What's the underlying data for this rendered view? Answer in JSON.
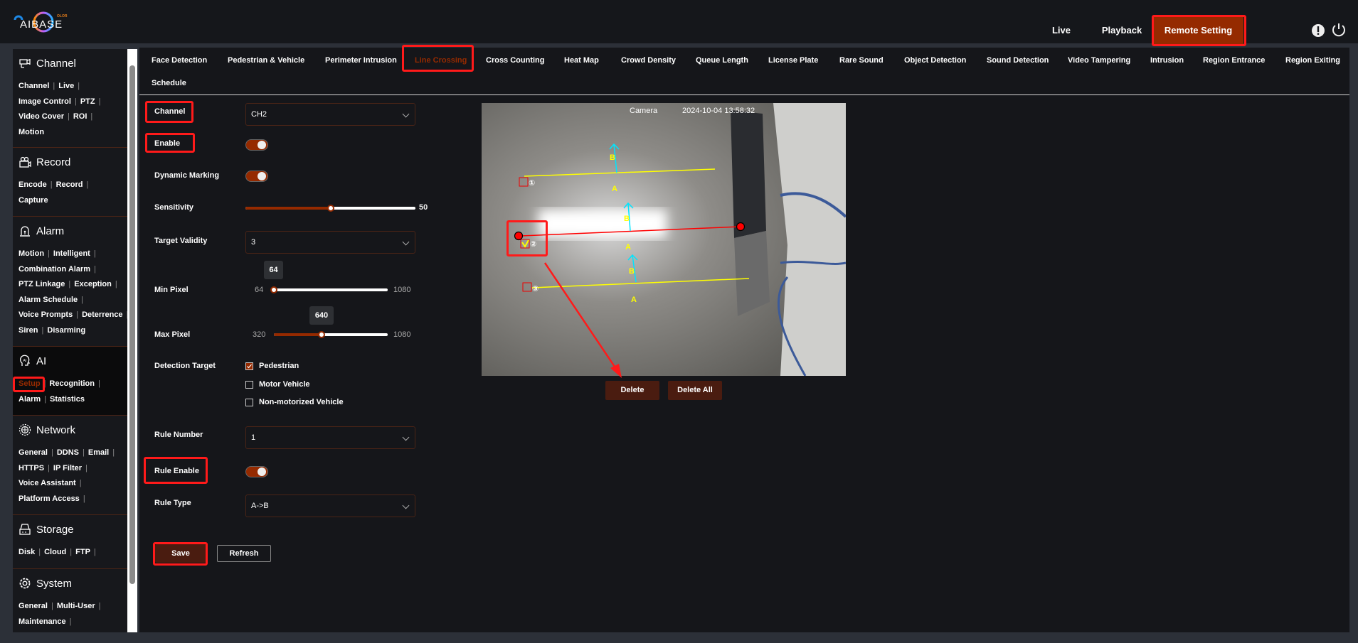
{
  "header": {
    "logo_text": "AIBASE",
    "logo_sub": "OLOR",
    "nav": [
      {
        "label": "Live"
      },
      {
        "label": "Playback"
      },
      {
        "label": "Remote Setting",
        "active": true
      }
    ],
    "icons": [
      "alert-icon",
      "power-icon"
    ]
  },
  "sidebar": {
    "sections": [
      {
        "title": "Channel",
        "icon": "camera-icon",
        "links": [
          "Channel",
          "Live",
          "Image Control",
          "PTZ",
          "Video Cover",
          "ROI",
          "Motion"
        ],
        "rows": [
          [
            0,
            1
          ],
          [
            2,
            3
          ],
          [
            4,
            5
          ],
          [
            6
          ]
        ]
      },
      {
        "title": "Record",
        "icon": "record-icon",
        "links": [
          "Encode",
          "Record",
          "Capture"
        ],
        "rows": [
          [
            0,
            1
          ],
          [
            2
          ]
        ]
      },
      {
        "title": "Alarm",
        "icon": "alarm-icon",
        "links": [
          "Motion",
          "Intelligent",
          "Combination Alarm",
          "PTZ Linkage",
          "Exception",
          "Alarm Schedule",
          "Voice Prompts",
          "Deterrence",
          "Siren",
          "Disarming"
        ],
        "rows": [
          [
            0,
            1
          ],
          [
            2
          ],
          [
            3,
            4
          ],
          [
            5
          ],
          [
            6,
            7
          ],
          [
            8,
            9
          ]
        ]
      },
      {
        "title": "AI",
        "icon": "ai-icon",
        "active": true,
        "links": [
          "Setup",
          "Recognition",
          "Alarm",
          "Statistics"
        ],
        "rows": [
          [
            0,
            1
          ],
          [
            2,
            3
          ]
        ],
        "active_link": "Setup"
      },
      {
        "title": "Network",
        "icon": "network-icon",
        "links": [
          "General",
          "DDNS",
          "Email",
          "HTTPS",
          "IP Filter",
          "Voice Assistant",
          "Platform Access"
        ],
        "rows": [
          [
            0,
            1,
            2
          ],
          [
            3,
            4
          ],
          [
            5
          ],
          [
            6
          ]
        ]
      },
      {
        "title": "Storage",
        "icon": "storage-icon",
        "links": [
          "Disk",
          "Cloud",
          "FTP"
        ],
        "rows": [
          [
            0,
            1,
            2
          ]
        ]
      },
      {
        "title": "System",
        "icon": "gear-icon",
        "links": [
          "General",
          "Multi-User",
          "Maintenance"
        ],
        "rows": [
          [
            0,
            1
          ],
          [
            2
          ]
        ]
      }
    ]
  },
  "tabs": [
    "Face Detection",
    "Pedestrian & Vehicle",
    "Perimeter Intrusion",
    "Line Crossing",
    "Cross Counting",
    "Heat Map",
    "Crowd Density",
    "Queue Length",
    "License Plate",
    "Rare Sound",
    "Object Detection",
    "Sound Detection",
    "Video Tampering",
    "Intrusion",
    "Region Entrance",
    "Region Exiting",
    "Schedule"
  ],
  "active_tab": "Line Crossing",
  "form": {
    "channel": {
      "label": "Channel",
      "value": "CH2"
    },
    "enable": {
      "label": "Enable",
      "on": true
    },
    "dynamic_marking": {
      "label": "Dynamic Marking",
      "on": true
    },
    "sensitivity": {
      "label": "Sensitivity",
      "value": "50",
      "min": 0,
      "max": 100
    },
    "target_validity": {
      "label": "Target Validity",
      "value": "3"
    },
    "min_pixel": {
      "label": "Min Pixel",
      "value": "64",
      "min": "64",
      "max": "1080"
    },
    "max_pixel": {
      "label": "Max Pixel",
      "value": "640",
      "min": "320",
      "max": "1080"
    },
    "detection_target": {
      "label": "Detection Target",
      "options": [
        {
          "label": "Pedestrian",
          "checked": true
        },
        {
          "label": "Motor Vehicle",
          "checked": false
        },
        {
          "label": "Non-motorized Vehicle",
          "checked": false
        }
      ]
    },
    "rule_number": {
      "label": "Rule Number",
      "value": "1"
    },
    "rule_enable": {
      "label": "Rule Enable",
      "on": true
    },
    "rule_type": {
      "label": "Rule Type",
      "value": "A->B"
    },
    "save": "Save",
    "refresh": "Refresh"
  },
  "camera": {
    "name": "Camera",
    "timestamp": "2024-10-04 13:58:32",
    "lines": [
      {
        "num": "①",
        "a": "A",
        "b": "B"
      },
      {
        "num": "②",
        "a": "A",
        "b": "B"
      },
      {
        "num": "③",
        "a": "A",
        "b": "B"
      }
    ],
    "delete": "Delete",
    "delete_all": "Delete All"
  },
  "colors": {
    "accent": "#952a00",
    "annotation": "#ff1a1a",
    "line": "#ffff00",
    "selected_line": "#ff0000",
    "arrow": "#00e5ff"
  }
}
